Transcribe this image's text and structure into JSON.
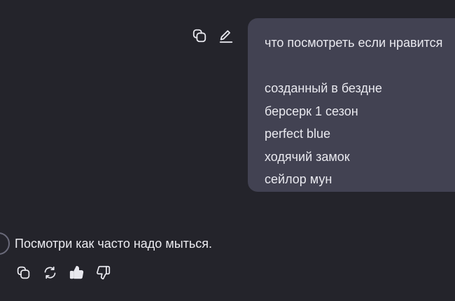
{
  "user_message": {
    "lines": [
      "что посмотреть если нравится",
      "",
      "созданный в бездне",
      "берсерк 1 сезон",
      "perfect blue",
      "ходячий замок",
      "сейлор мун"
    ],
    "actions": {
      "copy_icon": "copy-icon",
      "edit_icon": "edit-icon"
    }
  },
  "assistant_message": {
    "text": "Посмотри как часто надо мыться.",
    "actions": {
      "copy_icon": "copy-icon",
      "regenerate_icon": "regenerate-icon",
      "like_icon": "thumbs-up-icon",
      "dislike_icon": "thumbs-down-icon"
    }
  },
  "colors": {
    "background": "#24242b",
    "user_bubble": "#424252",
    "text": "#e9e9ef"
  }
}
